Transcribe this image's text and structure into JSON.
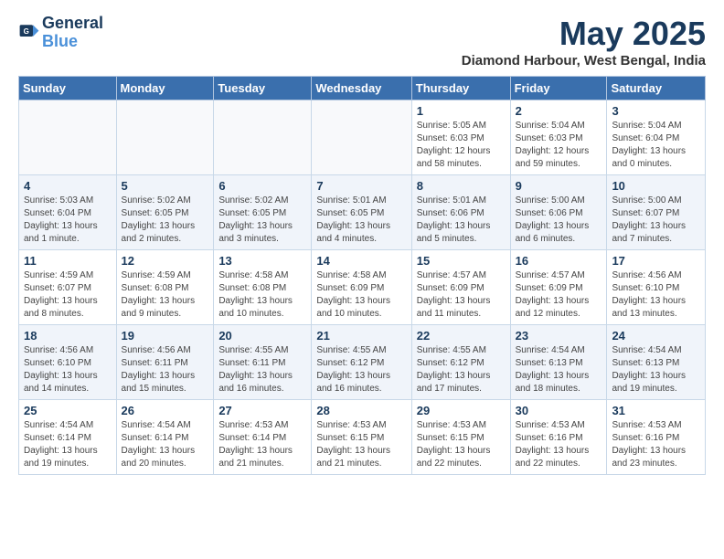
{
  "logo": {
    "line1": "General",
    "line2": "Blue"
  },
  "title": "May 2025",
  "location": "Diamond Harbour, West Bengal, India",
  "headers": [
    "Sunday",
    "Monday",
    "Tuesday",
    "Wednesday",
    "Thursday",
    "Friday",
    "Saturday"
  ],
  "weeks": [
    [
      {
        "day": "",
        "detail": ""
      },
      {
        "day": "",
        "detail": ""
      },
      {
        "day": "",
        "detail": ""
      },
      {
        "day": "",
        "detail": ""
      },
      {
        "day": "1",
        "detail": "Sunrise: 5:05 AM\nSunset: 6:03 PM\nDaylight: 12 hours\nand 58 minutes."
      },
      {
        "day": "2",
        "detail": "Sunrise: 5:04 AM\nSunset: 6:03 PM\nDaylight: 12 hours\nand 59 minutes."
      },
      {
        "day": "3",
        "detail": "Sunrise: 5:04 AM\nSunset: 6:04 PM\nDaylight: 13 hours\nand 0 minutes."
      }
    ],
    [
      {
        "day": "4",
        "detail": "Sunrise: 5:03 AM\nSunset: 6:04 PM\nDaylight: 13 hours\nand 1 minute."
      },
      {
        "day": "5",
        "detail": "Sunrise: 5:02 AM\nSunset: 6:05 PM\nDaylight: 13 hours\nand 2 minutes."
      },
      {
        "day": "6",
        "detail": "Sunrise: 5:02 AM\nSunset: 6:05 PM\nDaylight: 13 hours\nand 3 minutes."
      },
      {
        "day": "7",
        "detail": "Sunrise: 5:01 AM\nSunset: 6:05 PM\nDaylight: 13 hours\nand 4 minutes."
      },
      {
        "day": "8",
        "detail": "Sunrise: 5:01 AM\nSunset: 6:06 PM\nDaylight: 13 hours\nand 5 minutes."
      },
      {
        "day": "9",
        "detail": "Sunrise: 5:00 AM\nSunset: 6:06 PM\nDaylight: 13 hours\nand 6 minutes."
      },
      {
        "day": "10",
        "detail": "Sunrise: 5:00 AM\nSunset: 6:07 PM\nDaylight: 13 hours\nand 7 minutes."
      }
    ],
    [
      {
        "day": "11",
        "detail": "Sunrise: 4:59 AM\nSunset: 6:07 PM\nDaylight: 13 hours\nand 8 minutes."
      },
      {
        "day": "12",
        "detail": "Sunrise: 4:59 AM\nSunset: 6:08 PM\nDaylight: 13 hours\nand 9 minutes."
      },
      {
        "day": "13",
        "detail": "Sunrise: 4:58 AM\nSunset: 6:08 PM\nDaylight: 13 hours\nand 10 minutes."
      },
      {
        "day": "14",
        "detail": "Sunrise: 4:58 AM\nSunset: 6:09 PM\nDaylight: 13 hours\nand 10 minutes."
      },
      {
        "day": "15",
        "detail": "Sunrise: 4:57 AM\nSunset: 6:09 PM\nDaylight: 13 hours\nand 11 minutes."
      },
      {
        "day": "16",
        "detail": "Sunrise: 4:57 AM\nSunset: 6:09 PM\nDaylight: 13 hours\nand 12 minutes."
      },
      {
        "day": "17",
        "detail": "Sunrise: 4:56 AM\nSunset: 6:10 PM\nDaylight: 13 hours\nand 13 minutes."
      }
    ],
    [
      {
        "day": "18",
        "detail": "Sunrise: 4:56 AM\nSunset: 6:10 PM\nDaylight: 13 hours\nand 14 minutes."
      },
      {
        "day": "19",
        "detail": "Sunrise: 4:56 AM\nSunset: 6:11 PM\nDaylight: 13 hours\nand 15 minutes."
      },
      {
        "day": "20",
        "detail": "Sunrise: 4:55 AM\nSunset: 6:11 PM\nDaylight: 13 hours\nand 16 minutes."
      },
      {
        "day": "21",
        "detail": "Sunrise: 4:55 AM\nSunset: 6:12 PM\nDaylight: 13 hours\nand 16 minutes."
      },
      {
        "day": "22",
        "detail": "Sunrise: 4:55 AM\nSunset: 6:12 PM\nDaylight: 13 hours\nand 17 minutes."
      },
      {
        "day": "23",
        "detail": "Sunrise: 4:54 AM\nSunset: 6:13 PM\nDaylight: 13 hours\nand 18 minutes."
      },
      {
        "day": "24",
        "detail": "Sunrise: 4:54 AM\nSunset: 6:13 PM\nDaylight: 13 hours\nand 19 minutes."
      }
    ],
    [
      {
        "day": "25",
        "detail": "Sunrise: 4:54 AM\nSunset: 6:14 PM\nDaylight: 13 hours\nand 19 minutes."
      },
      {
        "day": "26",
        "detail": "Sunrise: 4:54 AM\nSunset: 6:14 PM\nDaylight: 13 hours\nand 20 minutes."
      },
      {
        "day": "27",
        "detail": "Sunrise: 4:53 AM\nSunset: 6:14 PM\nDaylight: 13 hours\nand 21 minutes."
      },
      {
        "day": "28",
        "detail": "Sunrise: 4:53 AM\nSunset: 6:15 PM\nDaylight: 13 hours\nand 21 minutes."
      },
      {
        "day": "29",
        "detail": "Sunrise: 4:53 AM\nSunset: 6:15 PM\nDaylight: 13 hours\nand 22 minutes."
      },
      {
        "day": "30",
        "detail": "Sunrise: 4:53 AM\nSunset: 6:16 PM\nDaylight: 13 hours\nand 22 minutes."
      },
      {
        "day": "31",
        "detail": "Sunrise: 4:53 AM\nSunset: 6:16 PM\nDaylight: 13 hours\nand 23 minutes."
      }
    ]
  ]
}
